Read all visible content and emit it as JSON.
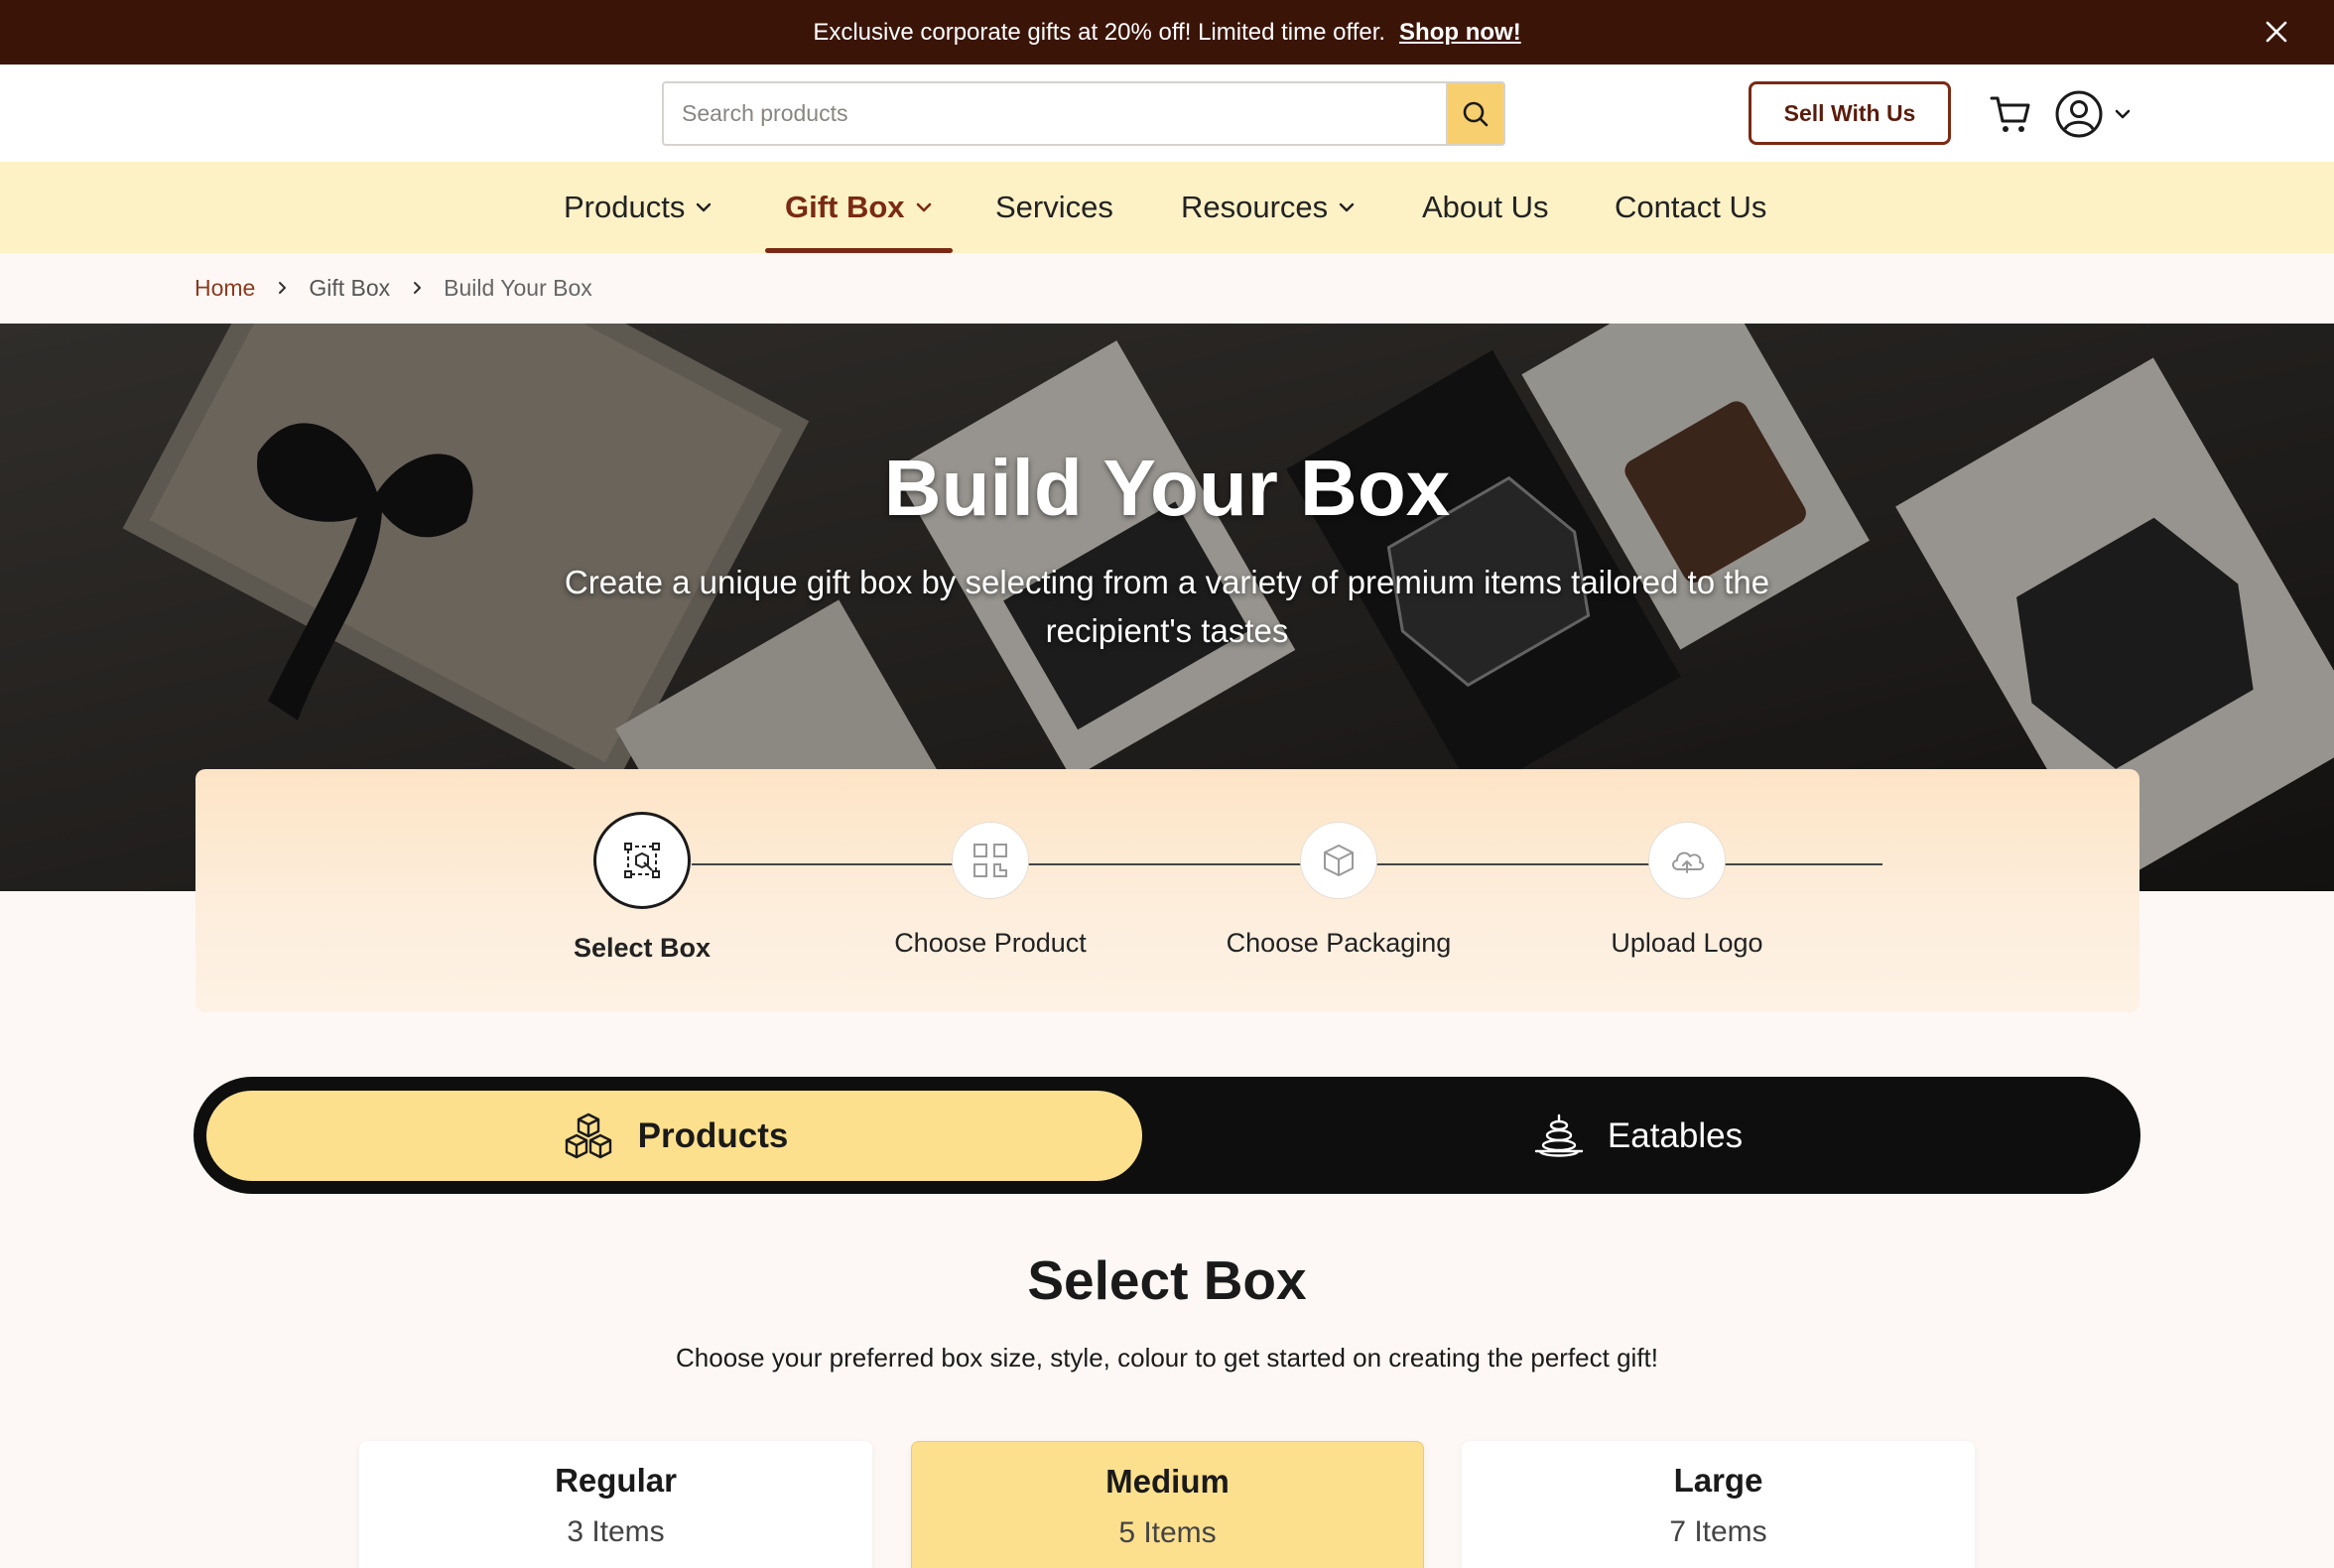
{
  "announcement": {
    "message": "Exclusive corporate gifts at 20% off! Limited time offer.",
    "cta": "Shop now!"
  },
  "header": {
    "search_placeholder": "Search products",
    "sell_label": "Sell With Us"
  },
  "nav": {
    "items": [
      {
        "label": "Products",
        "dropdown": true,
        "active": false
      },
      {
        "label": "Gift Box",
        "dropdown": true,
        "active": true
      },
      {
        "label": "Services",
        "dropdown": false,
        "active": false
      },
      {
        "label": "Resources",
        "dropdown": true,
        "active": false
      },
      {
        "label": "About Us",
        "dropdown": false,
        "active": false
      },
      {
        "label": "Contact Us",
        "dropdown": false,
        "active": false
      }
    ]
  },
  "breadcrumb": {
    "home": "Home",
    "parent": "Gift Box",
    "current": "Build Your Box"
  },
  "hero": {
    "title": "Build Your Box",
    "subtitle": "Create a unique gift box by selecting from a variety of premium items tailored to the recipient's tastes"
  },
  "stepper": {
    "steps": [
      {
        "label": "Select Box",
        "icon": "box-select-icon",
        "active": true
      },
      {
        "label": "Choose Product",
        "icon": "qr-product-icon",
        "active": false
      },
      {
        "label": "Choose Packaging",
        "icon": "package-icon",
        "active": false
      },
      {
        "label": "Upload Logo",
        "icon": "cloud-upload-icon",
        "active": false
      }
    ]
  },
  "tabs": {
    "products": "Products",
    "eatables": "Eatables"
  },
  "select_box": {
    "title": "Select Box",
    "subtitle": "Choose your preferred box size, style, colour to get started on creating the perfect gift!",
    "options": [
      {
        "name": "Regular",
        "count": "3 Items",
        "selected": false
      },
      {
        "name": "Medium",
        "count": "5 Items",
        "selected": true
      },
      {
        "name": "Large",
        "count": "7 Items",
        "selected": false
      }
    ]
  },
  "colors": {
    "announce_bg": "#3b1408",
    "brand_brown": "#7a2a14",
    "nav_bg": "#fdf1c6",
    "accent_yellow": "#fde08e",
    "search_button": "#f7cf6e"
  }
}
